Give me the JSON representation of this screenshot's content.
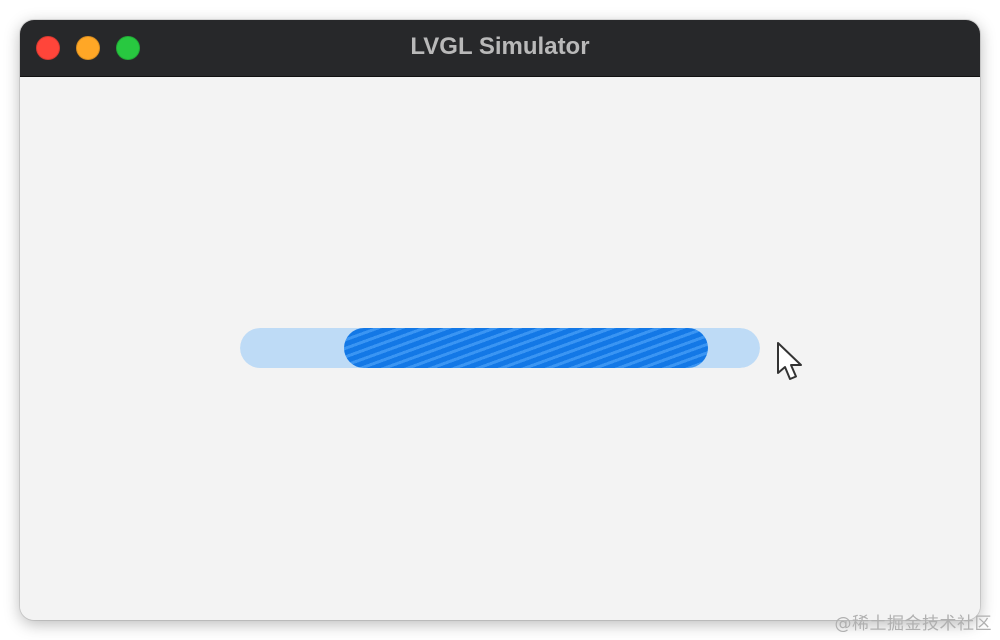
{
  "window": {
    "title": "LVGL Simulator",
    "controls": {
      "close_color": "#ff453a",
      "minimize_color": "#ffa726",
      "maximize_color": "#28c840"
    }
  },
  "progress_bar": {
    "range_start": 0.2,
    "range_end": 0.9,
    "track_color": "#bedbf6",
    "indicator_color": "#1378e6",
    "stripe_color": "#3a95f3"
  },
  "cursor": {
    "icon": "arrow-pointer-icon"
  },
  "watermark": {
    "text": "@稀土掘金技术社区"
  }
}
